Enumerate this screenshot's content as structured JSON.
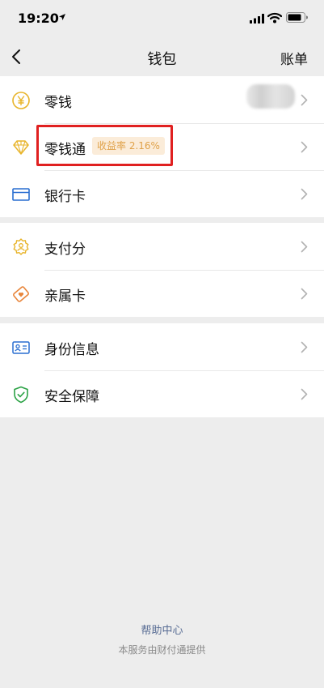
{
  "status_bar": {
    "time": "19:20",
    "icons": [
      "location-arrow-icon",
      "signal-icon",
      "wifi-icon",
      "battery-icon"
    ]
  },
  "nav": {
    "back_icon": "chevron-left-icon",
    "title": "钱包",
    "right_action": "账单"
  },
  "groups": [
    {
      "items": [
        {
          "label": "零钱",
          "icon": "yuan-coin-icon",
          "value": ""
        },
        {
          "label": "零钱通",
          "icon": "diamond-icon",
          "badge": "收益率 2.16%"
        },
        {
          "label": "银行卡",
          "icon": "bank-card-icon"
        }
      ]
    },
    {
      "items": [
        {
          "label": "支付分",
          "icon": "payment-score-icon"
        },
        {
          "label": "亲属卡",
          "icon": "family-card-icon"
        }
      ]
    },
    {
      "items": [
        {
          "label": "身份信息",
          "icon": "id-card-icon"
        },
        {
          "label": "安全保障",
          "icon": "shield-check-icon"
        }
      ]
    }
  ],
  "footer": {
    "help_link": "帮助中心",
    "note": "本服务由财付通提供"
  },
  "colors": {
    "background": "#ededed",
    "badge_text": "#e0a24a",
    "badge_bg": "#fbecd9",
    "highlight": "#e02020",
    "link": "#586c94"
  }
}
